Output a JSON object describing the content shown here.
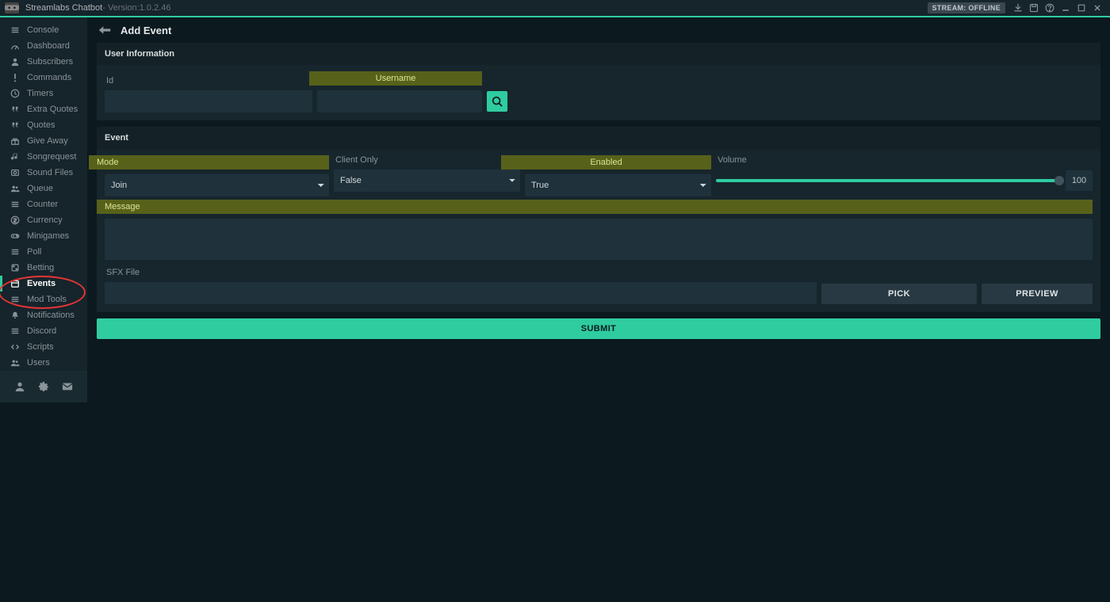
{
  "titlebar": {
    "app_name": "Streamlabs Chatbot",
    "version_prefix": " - Version: ",
    "version": "1.0.2.46",
    "stream_badge": "STREAM: OFFLINE"
  },
  "sidebar": {
    "items": [
      {
        "label": "Console",
        "icon": "list"
      },
      {
        "label": "Dashboard",
        "icon": "dashboard"
      },
      {
        "label": "Subscribers",
        "icon": "person"
      },
      {
        "label": "Commands",
        "icon": "bang"
      },
      {
        "label": "Timers",
        "icon": "clock"
      },
      {
        "label": "Extra Quotes",
        "icon": "quote"
      },
      {
        "label": "Quotes",
        "icon": "quote"
      },
      {
        "label": "Give Away",
        "icon": "gift"
      },
      {
        "label": "Songrequest",
        "icon": "music"
      },
      {
        "label": "Sound Files",
        "icon": "sound"
      },
      {
        "label": "Queue",
        "icon": "users"
      },
      {
        "label": "Counter",
        "icon": "list"
      },
      {
        "label": "Currency",
        "icon": "currency"
      },
      {
        "label": "Minigames",
        "icon": "gamepad"
      },
      {
        "label": "Poll",
        "icon": "list"
      },
      {
        "label": "Betting",
        "icon": "dice"
      },
      {
        "label": "Events",
        "icon": "calendar",
        "active": true
      },
      {
        "label": "Mod Tools",
        "icon": "list"
      },
      {
        "label": "Notifications",
        "icon": "bell"
      },
      {
        "label": "Discord",
        "icon": "list"
      },
      {
        "label": "Scripts",
        "icon": "code"
      },
      {
        "label": "Users",
        "icon": "users"
      }
    ]
  },
  "page": {
    "title": "Add Event"
  },
  "user_info": {
    "section_title": "User Information",
    "id_label": "Id",
    "username_label": "Username",
    "id_value": "",
    "username_value": ""
  },
  "event": {
    "section_title": "Event",
    "mode_label": "Mode",
    "clientonly_label": "Client Only",
    "enabled_label": "Enabled",
    "volume_label": "Volume",
    "mode_value": "Join",
    "clientonly_value": "False",
    "enabled_value": "True",
    "volume_value": "100",
    "message_label": "Message",
    "message_value": "",
    "sfx_label": "SFX File",
    "sfx_value": "",
    "pick_label": "PICK",
    "preview_label": "PREVIEW"
  },
  "submit_label": "SUBMIT"
}
